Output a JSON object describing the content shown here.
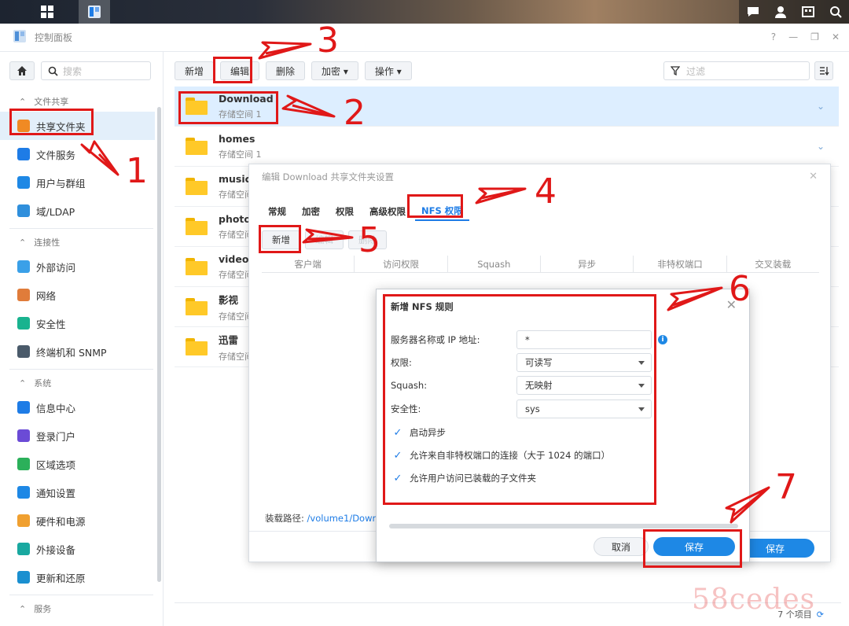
{
  "window": {
    "title": "控制面板",
    "controls": [
      "?",
      "—",
      "❐",
      "✕"
    ]
  },
  "sidebar": {
    "search_placeholder": "搜索",
    "sections": [
      {
        "label": "文件共享",
        "items": [
          {
            "label": "共享文件夹",
            "icon": "shared-folder-icon",
            "color": "#f08a24",
            "active": true
          },
          {
            "label": "文件服务",
            "icon": "file-services-icon",
            "color": "#1e7ce6"
          },
          {
            "label": "用户与群组",
            "icon": "users-icon",
            "color": "#1e88e5"
          },
          {
            "label": "域/LDAP",
            "icon": "domain-icon",
            "color": "#2f8fdc"
          }
        ]
      },
      {
        "label": "连接性",
        "items": [
          {
            "label": "外部访问",
            "icon": "external-access-icon",
            "color": "#3aa0e8"
          },
          {
            "label": "网络",
            "icon": "network-icon",
            "color": "#e07c3a"
          },
          {
            "label": "安全性",
            "icon": "security-shield-icon",
            "color": "#19b38f"
          },
          {
            "label": "终端机和 SNMP",
            "icon": "terminal-icon",
            "color": "#4a5a6a"
          }
        ]
      },
      {
        "label": "系统",
        "items": [
          {
            "label": "信息中心",
            "icon": "info-center-icon",
            "color": "#1e7ce6"
          },
          {
            "label": "登录门户",
            "icon": "login-portal-icon",
            "color": "#6b4bd6"
          },
          {
            "label": "区域选项",
            "icon": "region-icon",
            "color": "#2bb05a"
          },
          {
            "label": "通知设置",
            "icon": "notification-icon",
            "color": "#1e88e5"
          },
          {
            "label": "硬件和电源",
            "icon": "hardware-power-icon",
            "color": "#f0a030"
          },
          {
            "label": "外接设备",
            "icon": "external-device-icon",
            "color": "#19a8a0"
          },
          {
            "label": "更新和还原",
            "icon": "update-restore-icon",
            "color": "#1a8fd0"
          }
        ]
      },
      {
        "label": "服务",
        "items": []
      }
    ]
  },
  "toolbar": {
    "buttons": [
      "新增",
      "编辑",
      "删除",
      "加密 ▾",
      "操作 ▾"
    ],
    "filter_placeholder": "过滤"
  },
  "folders": [
    {
      "name": "Download",
      "storage": "存储空间 1",
      "selected": true
    },
    {
      "name": "homes",
      "storage": "存储空间 1"
    },
    {
      "name": "music",
      "storage": "存储空间"
    },
    {
      "name": "photo",
      "storage": "存储空间"
    },
    {
      "name": "video",
      "storage": "存储空间"
    },
    {
      "name": "影视",
      "storage": "存储空间"
    },
    {
      "name": "迅雷",
      "storage": "存储空间"
    }
  ],
  "edit_dialog": {
    "title": "编辑 Download 共享文件夹设置",
    "tabs": [
      "常规",
      "加密",
      "权限",
      "高级权限",
      "NFS 权限"
    ],
    "active_tab": "NFS 权限",
    "buttons": [
      "新增",
      "编辑",
      "删除"
    ],
    "columns": [
      "客户端",
      "访问权限",
      "Squash",
      "异步",
      "非特权端口",
      "交叉装载"
    ],
    "mount_label": "装载路径:",
    "mount_path": "/volume1/Down",
    "save": "保存"
  },
  "nfs_dialog": {
    "title": "新增 NFS 规则",
    "fields": [
      {
        "label": "服务器名称或 IP 地址:",
        "value": "*"
      },
      {
        "label": "权限:",
        "value": "可读写"
      },
      {
        "label": "Squash:",
        "value": "无映射"
      },
      {
        "label": "安全性:",
        "value": "sys"
      }
    ],
    "checks": [
      "启动异步",
      "允许来自非特权端口的连接（大于 1024 的端口）",
      "允许用户访问已装载的子文件夹"
    ],
    "cancel": "取消",
    "save": "保存"
  },
  "status": {
    "text": "7 个项目"
  },
  "annotations": [
    "1",
    "2",
    "3",
    "4",
    "5",
    "6",
    "7"
  ],
  "watermark": "58cedes"
}
